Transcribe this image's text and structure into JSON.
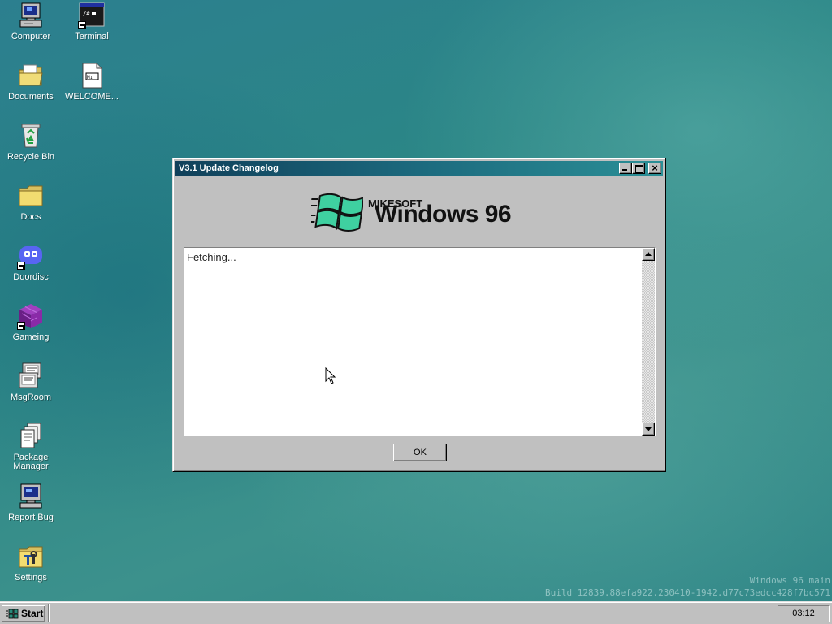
{
  "desktop": {
    "icons": [
      {
        "label": "Computer",
        "icon": "computer-icon",
        "shortcut": false
      },
      {
        "label": "Terminal",
        "icon": "terminal-icon",
        "shortcut": true
      },
      {
        "label": "Documents",
        "icon": "documents-folder-icon",
        "shortcut": false
      },
      {
        "label": "WELCOME...",
        "icon": "markdown-file-icon",
        "shortcut": false
      },
      {
        "label": "Recycle Bin",
        "icon": "recycle-bin-icon",
        "shortcut": false
      },
      {
        "label": "Docs",
        "icon": "folder-icon",
        "shortcut": false
      },
      {
        "label": "Doordisc",
        "icon": "doordisc-icon",
        "shortcut": true
      },
      {
        "label": "Gameing",
        "icon": "cube-icon",
        "shortcut": true
      },
      {
        "label": "MsgRoom",
        "icon": "msgroom-icon",
        "shortcut": false
      },
      {
        "label": "Package Manager",
        "icon": "package-manager-icon",
        "shortcut": false
      },
      {
        "label": "Report Bug",
        "icon": "report-bug-icon",
        "shortcut": false
      },
      {
        "label": "Settings",
        "icon": "settings-icon",
        "shortcut": false
      }
    ],
    "watermark": {
      "line1": "Windows 96 main",
      "line2": "Build 12839.88efa922.230410-1942.d77c73edcc428f7bc571"
    }
  },
  "window": {
    "title": "V3.1 Update Changelog",
    "logo": {
      "brand_small": "MIKESOFT",
      "brand_big": "Windows 96"
    },
    "changelog_text": "Fetching...",
    "ok_label": "OK"
  },
  "taskbar": {
    "start_label": "Start",
    "clock": "03:12"
  },
  "colors": {
    "desktop_teal": "#2b8686",
    "titlebar_start": "#10405a",
    "titlebar_end": "#2b8f96",
    "chrome_gray": "#c0c0c0",
    "logo_green": "#3fd0a0"
  }
}
